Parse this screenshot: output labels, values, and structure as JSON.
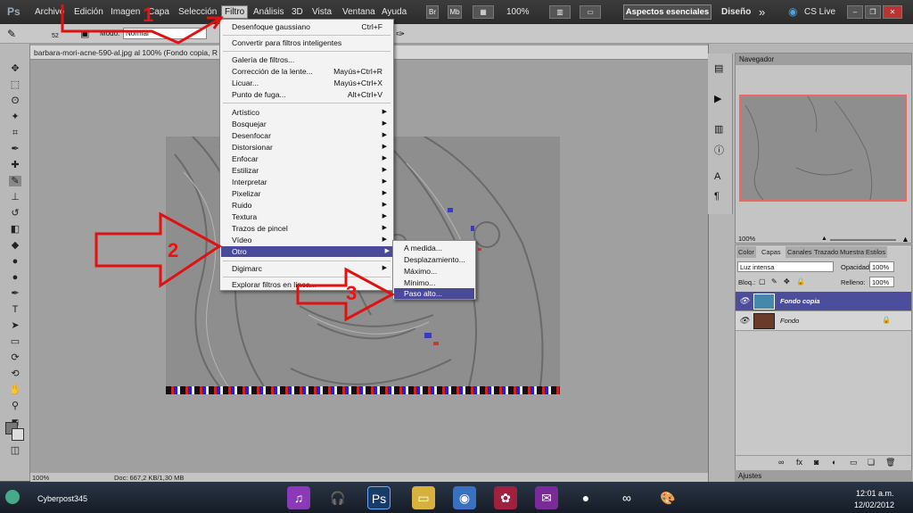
{
  "menubar": {
    "ps_logo": "Ps",
    "items": [
      "Archivo",
      "Edición",
      "Imagen",
      "Capa",
      "Selección",
      "Filtro",
      "Análisis",
      "3D",
      "Vista",
      "Ventana",
      "Ayuda"
    ],
    "zoom": "100%",
    "workspace_active": "Aspectos esenciales",
    "workspace_alt": "Diseño",
    "more": "»",
    "cslive": "CS Live"
  },
  "options": {
    "brush_size": "52",
    "mode_label": "Modo:",
    "mode_value": "Normal"
  },
  "document": {
    "tab_title": "barbara-mori-acne-590-al.jpg al 100% (Fondo copia, R",
    "status_zoom": "100%",
    "status_doc": "Doc: 667,2 KB/1,30 MB"
  },
  "filter_menu": {
    "items": [
      {
        "label": "Desenfoque gaussiano",
        "shortcut": "Ctrl+F"
      },
      {
        "label": "Convertir para filtros inteligentes"
      },
      {
        "label": "Galería de filtros..."
      },
      {
        "label": "Corrección de la lente...",
        "shortcut": "Mayús+Ctrl+R"
      },
      {
        "label": "Licuar...",
        "shortcut": "Mayús+Ctrl+X"
      },
      {
        "label": "Punto de fuga...",
        "shortcut": "Alt+Ctrl+V"
      },
      {
        "label": "Artístico"
      },
      {
        "label": "Bosquejar"
      },
      {
        "label": "Desenfocar"
      },
      {
        "label": "Distorsionar"
      },
      {
        "label": "Enfocar"
      },
      {
        "label": "Estilizar"
      },
      {
        "label": "Interpretar"
      },
      {
        "label": "Pixelizar"
      },
      {
        "label": "Ruido"
      },
      {
        "label": "Textura"
      },
      {
        "label": "Trazos de pincel"
      },
      {
        "label": "Vídeo"
      },
      {
        "label": "Otro"
      },
      {
        "label": "Digimarc"
      },
      {
        "label": "Explorar filtros en línea..."
      }
    ]
  },
  "submenu_otro": {
    "items": [
      "A medida...",
      "Desplazamiento...",
      "Máximo...",
      "Mínimo...",
      "Paso alto..."
    ]
  },
  "annotations": [
    "1",
    "2",
    "3"
  ],
  "navigator": {
    "title": "Navegador",
    "zoom": "100%"
  },
  "layers": {
    "tabs": [
      "Color",
      "Capas",
      "Canales",
      "Trazados",
      "Muestras",
      "Estilos"
    ],
    "blend_mode": "Luz intensa",
    "opacity_label": "Opacidad:",
    "opacity": "100%",
    "lock_label": "Bloq.:",
    "fill_label": "Relleno:",
    "fill": "100%",
    "rows": [
      {
        "name": "Fondo copia",
        "selected": true
      },
      {
        "name": "Fondo",
        "selected": false
      }
    ]
  },
  "adjustments": {
    "title": "Ajustes"
  },
  "taskbar": {
    "user": "Cyberpost345",
    "time": "12:01 a.m.",
    "date": "12/02/2012"
  },
  "colors": {
    "highlight": "#4a4a9a",
    "annotation": "#e11111",
    "layer_selected": "#4d4d9e"
  }
}
